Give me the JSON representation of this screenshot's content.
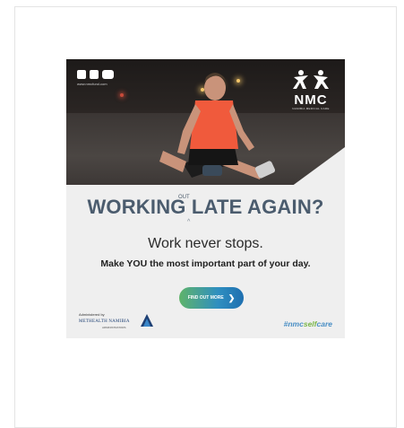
{
  "ad": {
    "site": "www.nmcfund.com",
    "logo": {
      "brand": "NMC",
      "sub": "NAMIBIA MEDICAL CARE"
    },
    "headline_insert": "OUT",
    "headline": "WORKING LATE AGAIN?",
    "line1": "Work never stops.",
    "line2": "Make YOU the most important part of your day.",
    "cta_label": "FIND OUT MORE",
    "admin_label": "Administered by",
    "administrator": "METHEALTH NAMIBIA",
    "administrator_sub": "ADMINISTRATORS",
    "hashtag_a": "#nmc",
    "hashtag_b": "self",
    "hashtag_c": "care",
    "social_icons": [
      "facebook-icon",
      "instagram-icon",
      "youtube-icon"
    ],
    "colors": {
      "headline": "#4b5c6e",
      "cta_start": "#5fb36a",
      "cta_end": "#1e6fb0",
      "hashtag": "#4a8fc5",
      "hashtag_accent": "#7ab648",
      "shirt": "#f05a3c"
    }
  }
}
